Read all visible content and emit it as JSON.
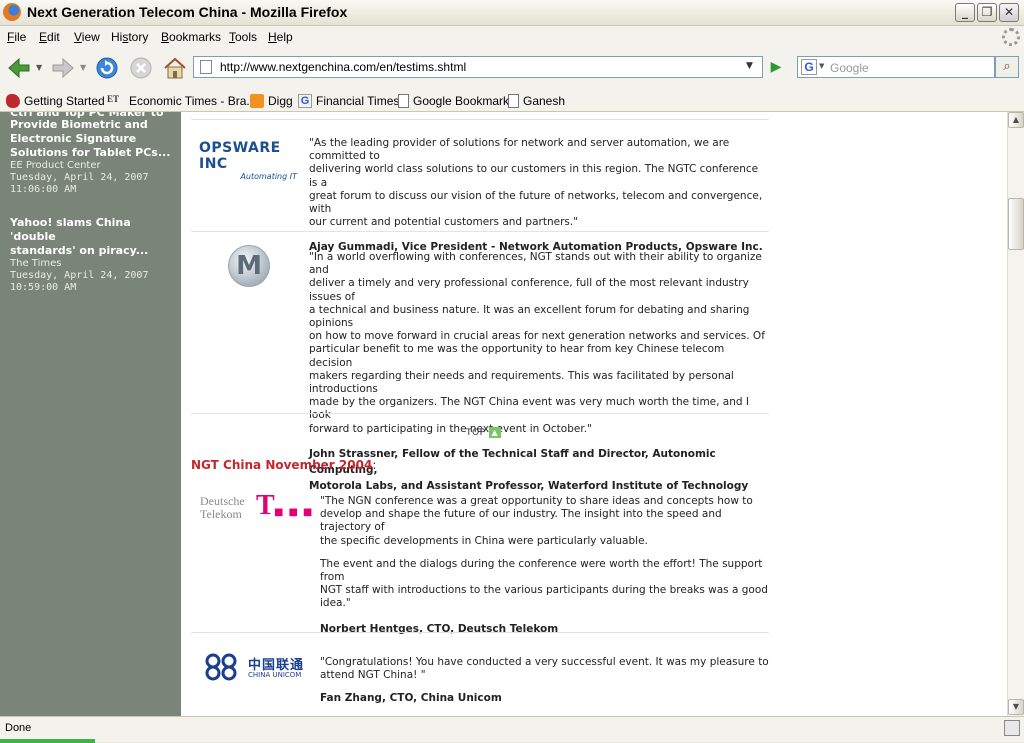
{
  "window": {
    "title": "Next Generation Telecom China - Mozilla Firefox"
  },
  "menu": [
    "File",
    "Edit",
    "View",
    "History",
    "Bookmarks",
    "Tools",
    "Help"
  ],
  "menu_access": [
    "F",
    "E",
    "V",
    "s",
    "B",
    "T",
    "H"
  ],
  "nav": {
    "url": "http://www.nextgenchina.com/en/testims.shtml",
    "search_placeholder": "Google",
    "search_engine_letter": "G"
  },
  "bookmarks": [
    {
      "label": "Getting Started",
      "icon": "firefox-icon"
    },
    {
      "label": "Economic Times - Bra...",
      "icon": "et-icon",
      "icon_text": "ET"
    },
    {
      "label": "Digg",
      "icon": "rss-icon"
    },
    {
      "label": "Financial Times",
      "icon": "google-g-icon"
    },
    {
      "label": "Google Bookmark",
      "icon": "page-icon"
    },
    {
      "label": "Ganesh",
      "icon": "page-icon"
    }
  ],
  "sidebar": {
    "news": [
      {
        "title_lines": [
          "Provide Biometric and",
          "Electronic Signature",
          "Solutions for Tablet PCs..."
        ],
        "source": "EE Product Center",
        "date": "Tuesday, April 24, 2007",
        "time": "11:06:00 AM"
      },
      {
        "title_lines": [
          "Yahoo! slams China 'double",
          "standards' on piracy..."
        ],
        "source": "The Times",
        "date": "Tuesday, April 24, 2007",
        "time": "10:59:00 AM"
      }
    ]
  },
  "testimonials_top": [
    {
      "logo_text": "OPSWARE INC",
      "logo_tagline": "Automating IT",
      "quote_lines": [
        "\"As the leading provider of solutions for network and server automation, we are committed to",
        "delivering world class solutions to our customers in this region. The NGTC conference is a",
        "great forum to discuss our vision of the future of networks, telecom and convergence, with",
        "our current and potential customers and partners.\""
      ],
      "author_lines": [
        "Ajay Gummadi, Vice President - Network Automation Products, Opsware Inc."
      ]
    },
    {
      "logo_text": "M",
      "quote_lines": [
        "\"In a world overflowing with conferences, NGT stands out with their ability to organize and",
        "deliver a timely and very professional conference, full of the most relevant industry issues of",
        "a technical and business nature. It was an excellent forum for debating and sharing opinions",
        "on how to move forward in crucial areas for next generation networks and services. Of",
        "particular benefit to me was the opportunity to hear from key Chinese telecom decision",
        "makers regarding their needs and requirements. This was facilitated by personal introductions",
        "made by the organizers. The NGT China event was very much worth the time, and I look",
        "forward to participating in the next event in October.\""
      ],
      "author_lines": [
        "John Strassner, Fellow of the Technical Staff and Director, Autonomic Computing,",
        "Motorola Labs, and Assistant Professor, Waterford Institute of Technology"
      ]
    }
  ],
  "top_link": "TOP",
  "section": {
    "title": "NGT China November 2004",
    "suffix": ":"
  },
  "testimonials_bottom": [
    {
      "logo_text_lines": [
        "Deutsche",
        "Telekom"
      ],
      "logo_mark": "T",
      "quote_lines": [
        "\"The NGN conference was a great opportunity to share ideas and concepts how to",
        "develop and shape the future of our industry. The insight into the speed and trajectory of",
        "the specific developments in China were particularly valuable."
      ],
      "quote2_lines": [
        "The event and the dialogs during the conference were worth the effort! The support from",
        "NGT staff with introductions to the various participants during the breaks was a good",
        "idea.\""
      ],
      "author_lines": [
        "Norbert Hentges, CTO, Deutsch Telekom"
      ]
    },
    {
      "logo_text_cn": "中国联通",
      "logo_text_en": "CHINA UNICOM",
      "quote_lines": [
        "\"Congratulations! You have conducted a very successful event. It was my pleasure to",
        "attend NGT China! \""
      ],
      "author_lines": [
        "Fan Zhang, CTO, China Unicom"
      ]
    }
  ],
  "status": {
    "text": "Done"
  },
  "colors": {
    "sidebar_bg": "#7b8479",
    "section_title": "#c4262e",
    "telekom_magenta": "#e20074",
    "opsware_blue": "#1b4f8f",
    "unicom_blue": "#1a3f8f"
  }
}
